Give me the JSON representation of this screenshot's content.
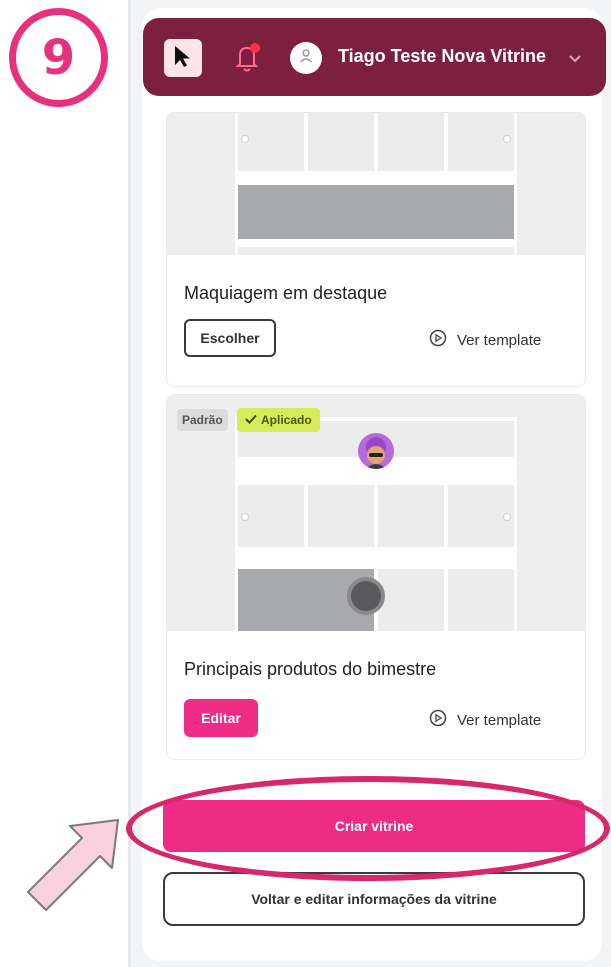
{
  "step": {
    "number": "9"
  },
  "header": {
    "user_name": "Tiago Teste Nova Vitrine",
    "icons": [
      "cursor-icon",
      "bell-icon",
      "user-icon",
      "chevron-down-icon"
    ]
  },
  "templates": [
    {
      "title": "Maquiagem em destaque",
      "action_label": "Escolher",
      "preview_label": "Ver template"
    },
    {
      "tag_default": "Padrão",
      "tag_applied": "Aplicado",
      "title": "Principais produtos do bimestre",
      "action_label": "Editar",
      "preview_label": "Ver template"
    }
  ],
  "footer": {
    "create_label": "Criar vitrine",
    "back_label": "Voltar e editar informações da vitrine"
  },
  "colors": {
    "accent": "#ee2c86",
    "header_bg": "#7d1f3f",
    "applied_tag": "#d6ec5a",
    "annotation": "#e8317c"
  }
}
